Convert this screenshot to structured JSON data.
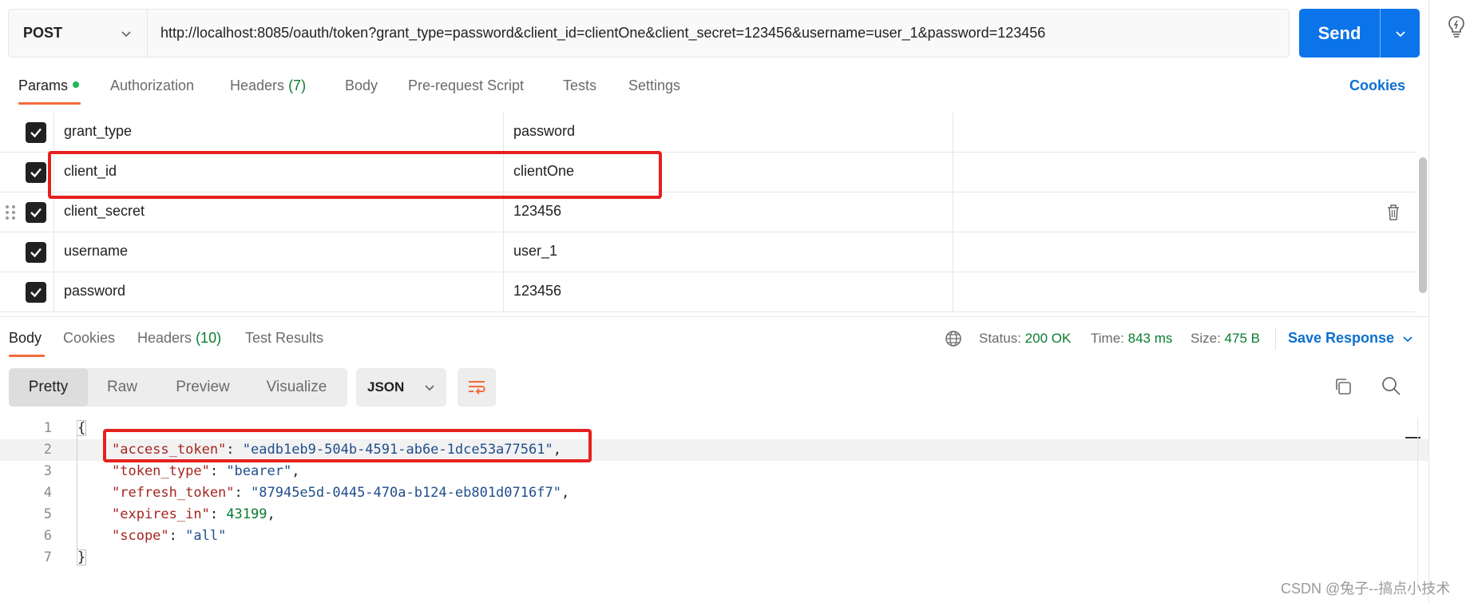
{
  "request": {
    "method": "POST",
    "url": "http://localhost:8085/oauth/token?grant_type=password&client_id=clientOne&client_secret=123456&username=user_1&password=123456",
    "send_label": "Send"
  },
  "request_tabs": {
    "params": "Params",
    "authorization": "Authorization",
    "headers": "Headers",
    "headers_count": "(7)",
    "body": "Body",
    "pre_request_script": "Pre-request Script",
    "tests": "Tests",
    "settings": "Settings",
    "cookies": "Cookies"
  },
  "params": [
    {
      "key": "grant_type",
      "value": "password",
      "checked": true
    },
    {
      "key": "client_id",
      "value": "clientOne",
      "checked": true
    },
    {
      "key": "client_secret",
      "value": "123456",
      "checked": true
    },
    {
      "key": "username",
      "value": "user_1",
      "checked": true
    },
    {
      "key": "password",
      "value": "123456",
      "checked": true
    }
  ],
  "response_tabs": {
    "body": "Body",
    "cookies": "Cookies",
    "headers": "Headers",
    "headers_count": "(10)",
    "test_results": "Test Results"
  },
  "status": {
    "status_label": "Status:",
    "status_value": "200 OK",
    "time_label": "Time:",
    "time_value": "843 ms",
    "size_label": "Size:",
    "size_value": "475 B",
    "save_response": "Save Response"
  },
  "view": {
    "pretty": "Pretty",
    "raw": "Raw",
    "preview": "Preview",
    "visualize": "Visualize",
    "format": "JSON"
  },
  "code": {
    "line_numbers": [
      "1",
      "2",
      "3",
      "4",
      "5",
      "6",
      "7"
    ],
    "open_brace": "{",
    "close_brace": "}",
    "access_token_key": "\"access_token\"",
    "access_token_value": "\"eadb1eb9-504b-4591-ab6e-1dce53a77561\"",
    "token_type_key": "\"token_type\"",
    "token_type_value": "\"bearer\"",
    "refresh_token_key": "\"refresh_token\"",
    "refresh_token_value": "\"87945e5d-0445-470a-b124-eb801d0716f7\"",
    "expires_in_key": "\"expires_in\"",
    "expires_in_value": "43199",
    "scope_key": "\"scope\"",
    "scope_value": "\"all\""
  },
  "watermark": "CSDN @兔子--搞点小技术",
  "colors": {
    "accent_orange": "#f26b3a",
    "send_blue": "#0c74eb",
    "link_blue": "#0c6fd1",
    "status_green": "#0a7d2f",
    "annotation_red": "#e5201f"
  },
  "icons": [
    "chevron-down-icon",
    "lightbulb-icon",
    "checkbox-checked-icon",
    "drag-handle-icon",
    "trash-icon",
    "globe-icon",
    "wrap-lines-icon",
    "copy-icon",
    "search-icon"
  ]
}
